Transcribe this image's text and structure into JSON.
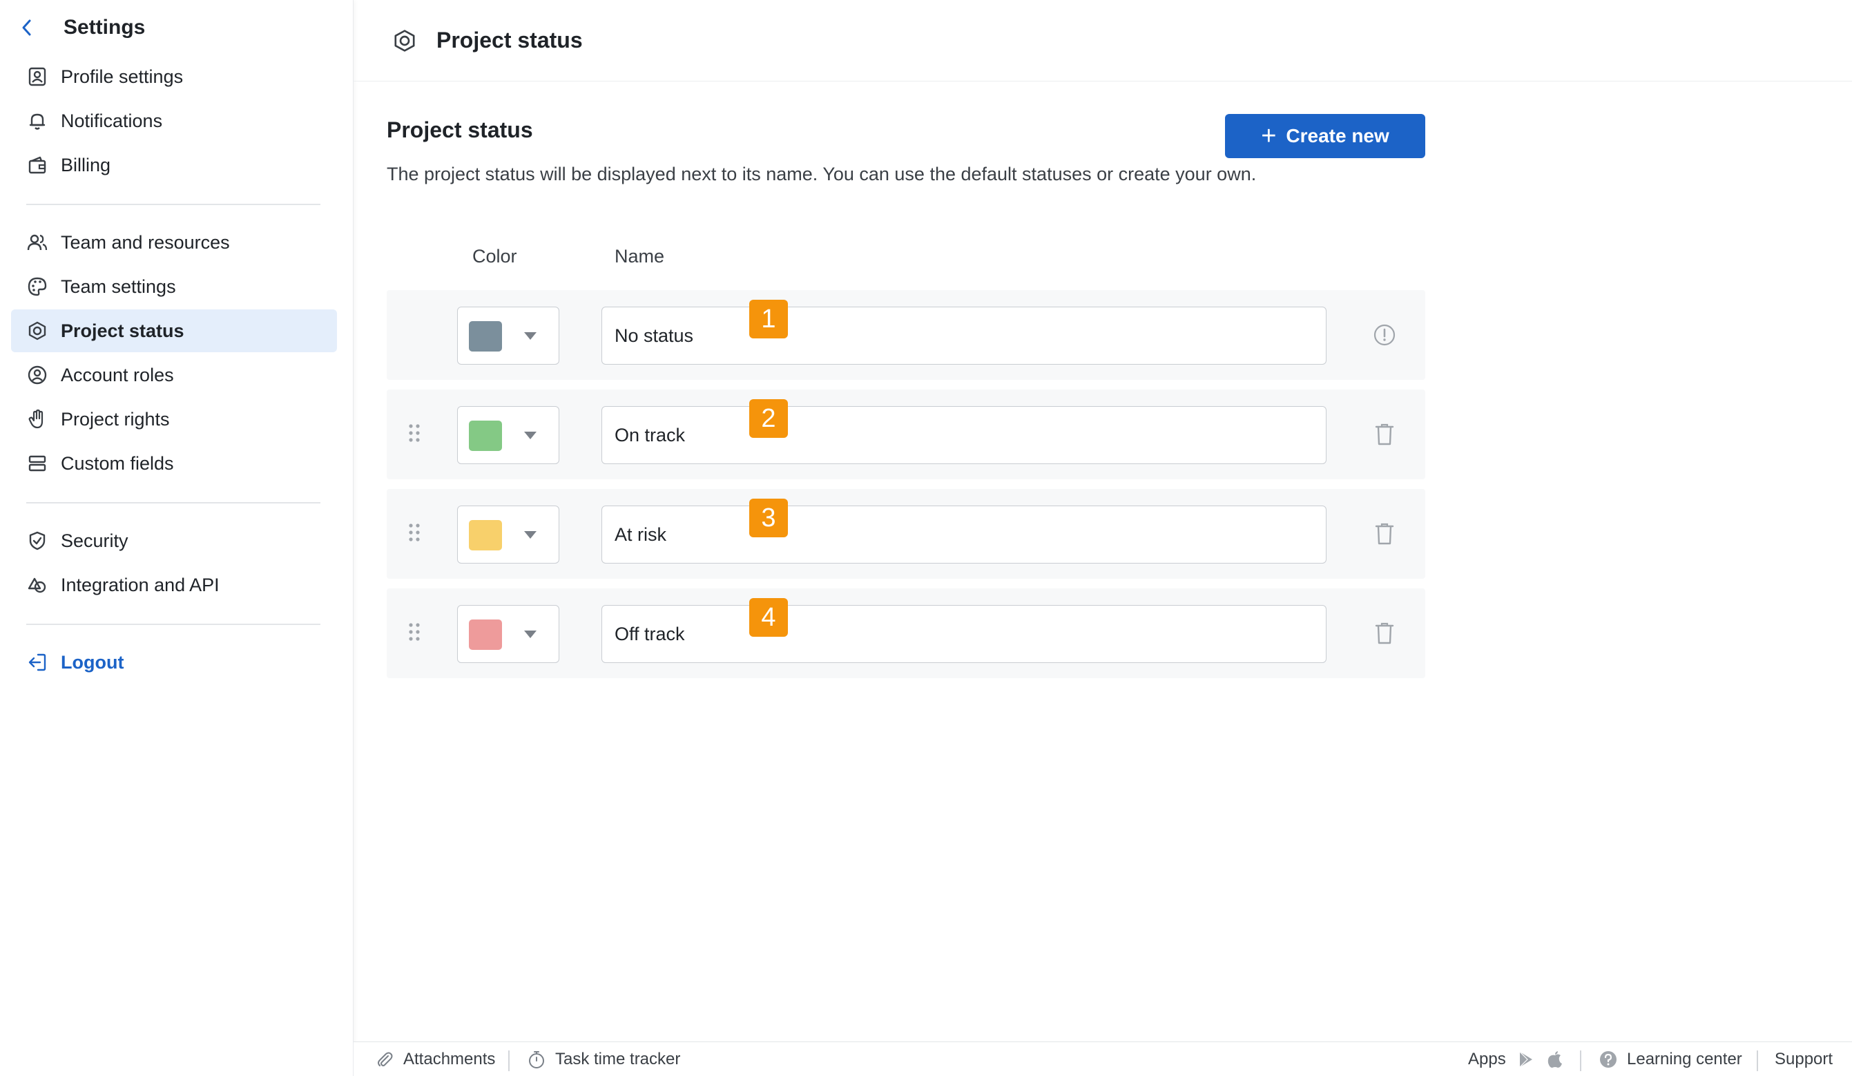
{
  "sidebar": {
    "title": "Settings",
    "back_icon": "chevron-left-icon",
    "items": [
      {
        "label": "Profile settings",
        "icon": "profile-card-icon"
      },
      {
        "label": "Notifications",
        "icon": "bell-icon"
      },
      {
        "label": "Billing",
        "icon": "wallet-icon"
      },
      {
        "label": "Team and resources",
        "icon": "users-icon"
      },
      {
        "label": "Team settings",
        "icon": "palette-icon"
      },
      {
        "label": "Project status",
        "icon": "status-icon",
        "active": true
      },
      {
        "label": "Account roles",
        "icon": "user-circle-icon"
      },
      {
        "label": "Project rights",
        "icon": "hand-icon"
      },
      {
        "label": "Custom fields",
        "icon": "fields-icon"
      },
      {
        "label": "Security",
        "icon": "shield-icon"
      },
      {
        "label": "Integration and API",
        "icon": "integration-icon"
      }
    ],
    "logout_label": "Logout"
  },
  "header": {
    "title": "Project status",
    "icon": "status-icon"
  },
  "main": {
    "section_title": "Project status",
    "description": "The project status will be displayed next to its name. You can use the default statuses or create your own.",
    "create_button_label": "Create new",
    "columns": {
      "color": "Color",
      "name": "Name"
    },
    "statuses": [
      {
        "name": "No status",
        "color": "#7b8f9c",
        "badge": "1",
        "action_icon": "info-icon",
        "draggable": false
      },
      {
        "name": "On track",
        "color": "#84c985",
        "badge": "2",
        "action_icon": "trash-icon",
        "draggable": true
      },
      {
        "name": "At risk",
        "color": "#f8d06b",
        "badge": "3",
        "action_icon": "trash-icon",
        "draggable": true
      },
      {
        "name": "Off track",
        "color": "#ee9b9b",
        "badge": "4",
        "action_icon": "trash-icon",
        "draggable": true
      }
    ]
  },
  "footer": {
    "attachments": "Attachments",
    "task_time_tracker": "Task time tracker",
    "apps": "Apps",
    "learning_center": "Learning center",
    "support": "Support"
  },
  "colors": {
    "accent": "#1c63c7",
    "active_nav_bg": "#e4eefb",
    "badge": "#f5940b"
  }
}
